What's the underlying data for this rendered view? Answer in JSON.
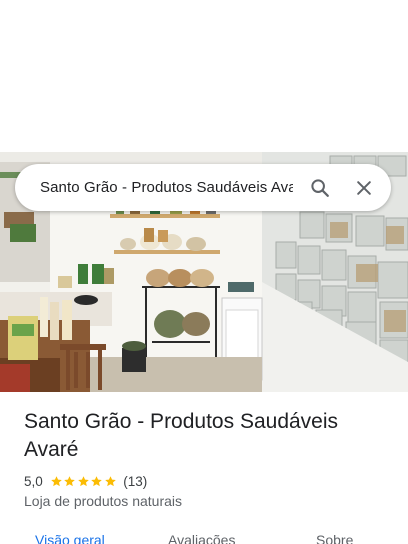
{
  "search": {
    "query": "Santo Grão - Produtos Saudáveis Avaré",
    "search_icon": "search-icon",
    "close_icon": "close-icon"
  },
  "place": {
    "name": "Santo Grão - Produtos Saudáveis Avaré",
    "rating": "5,0",
    "stars": 5,
    "review_count": "(13)",
    "category": "Loja de produtos naturais"
  },
  "tabs": [
    {
      "label": "Visão geral",
      "active": true
    },
    {
      "label": "Avaliações",
      "active": false
    },
    {
      "label": "Sobre",
      "active": false
    }
  ],
  "colors": {
    "accent": "#1a73e8",
    "star": "#fbbc04",
    "text_primary": "#202124",
    "text_secondary": "#5f6368"
  }
}
